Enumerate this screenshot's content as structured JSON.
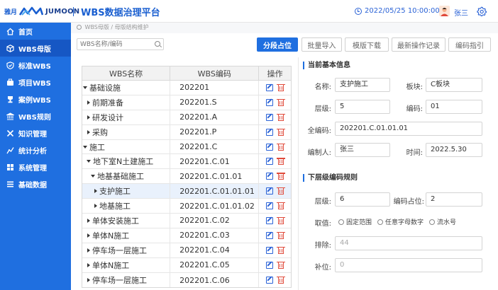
{
  "header": {
    "logo_cn": "雅月",
    "logo_en": "JUMOON",
    "title": "WBS数据治理平台",
    "datetime": "2022/05/25  10:00:00",
    "user": "张三"
  },
  "sidebar": {
    "items": [
      {
        "label": "首页",
        "icon": "home-icon"
      },
      {
        "label": "WBS母版",
        "icon": "cube-icon"
      },
      {
        "label": "标准WBS",
        "icon": "shield-check-icon"
      },
      {
        "label": "项目WBS",
        "icon": "briefcase-icon"
      },
      {
        "label": "案例WBS",
        "icon": "case-icon"
      },
      {
        "label": "WBS规则",
        "icon": "rules-icon"
      },
      {
        "label": "知识管理",
        "icon": "tools-icon"
      },
      {
        "label": "统计分析",
        "icon": "analysis-icon"
      },
      {
        "label": "系统管理",
        "icon": "grid-icon"
      },
      {
        "label": "基础数据",
        "icon": "list-icon"
      }
    ],
    "active_index": 1
  },
  "breadcrumb": "WBS母版 / 母版结构维护",
  "search": {
    "placeholder": "WBS名称/编码"
  },
  "toolbar": {
    "segment": "分段占位",
    "batch_import": "批量导入",
    "template_download": "模版下载",
    "latest_ops": "最新操作记录",
    "code_guide": "编码指引"
  },
  "table": {
    "headers": [
      "WBS名称",
      "WBS编码",
      "操作"
    ],
    "rows": [
      {
        "name": "基础设施",
        "code": "202201",
        "caret": "down"
      },
      {
        "name": "前期准备",
        "code": "202201.S",
        "caret": "right"
      },
      {
        "name": "研发设计",
        "code": "202201.A",
        "caret": "right"
      },
      {
        "name": "采购",
        "code": "202201.P",
        "caret": "right"
      },
      {
        "name": "施工",
        "code": "202201.C",
        "caret": "down"
      },
      {
        "name": "地下室N土建施工",
        "code": "202201.C.01",
        "caret": "down"
      },
      {
        "name": "地基基础施工",
        "code": "202201.C.01.01",
        "caret": "down"
      },
      {
        "name": "支护施工",
        "code": "202201.C.01.01.01",
        "caret": "right"
      },
      {
        "name": "地基施工",
        "code": "202201.C.01.01.02",
        "caret": "right"
      },
      {
        "name": "单体安装施工",
        "code": "202201.C.02",
        "caret": "right"
      },
      {
        "name": "单体N施工",
        "code": "202201.C.03",
        "caret": "right"
      },
      {
        "name": "停车场一层施工",
        "code": "202201.C.04",
        "caret": "right"
      },
      {
        "name": "单体N施工",
        "code": "202201.C.05",
        "caret": "right"
      },
      {
        "name": "停车场一层施工",
        "code": "202201.C.06",
        "caret": "right"
      }
    ],
    "selected_index": 7
  },
  "basic_info": {
    "title": "当前基本信息",
    "name_label": "名称:",
    "name_value": "支护施工",
    "block_label": "板块:",
    "block_value": "C板块",
    "level_label": "层级:",
    "level_value": "5",
    "code_label": "编码:",
    "code_value": "01",
    "fullcode_label": "全编码:",
    "fullcode_value": "202201.C.01.01.01",
    "author_label": "编制人:",
    "author_value": "张三",
    "time_label": "时间:",
    "time_value": "2022.5.30"
  },
  "sub_rules": {
    "title": "下层级编码规则",
    "level_label": "层级:",
    "level_value": "6",
    "digits_label": "编码占位:",
    "digits_value": "2",
    "value_label": "取值:",
    "options": [
      "固定范围",
      "任意字母数字",
      "流水号"
    ],
    "exclude_label": "排除:",
    "exclude_placeholder": "44",
    "pad_label": "补位:",
    "pad_placeholder": "0"
  },
  "colors": {
    "brand": "#1f6fe0",
    "sidebar_active": "#1657c4",
    "edit": "#2a62d6",
    "delete": "#e04a3a"
  }
}
